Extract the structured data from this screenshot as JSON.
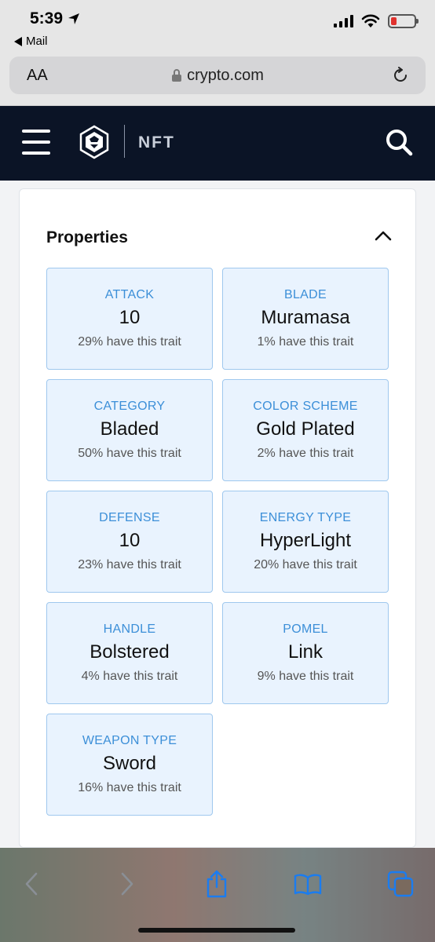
{
  "status": {
    "time": "5:39",
    "back_app": "Mail"
  },
  "browser": {
    "text_size_label": "AA",
    "url": "crypto.com"
  },
  "site": {
    "section_label": "NFT"
  },
  "properties": {
    "title": "Properties",
    "traits": [
      {
        "label": "ATTACK",
        "value": "10",
        "rarity": "29% have this trait"
      },
      {
        "label": "BLADE",
        "value": "Muramasa",
        "rarity": "1% have this trait"
      },
      {
        "label": "CATEGORY",
        "value": "Bladed",
        "rarity": "50% have this trait"
      },
      {
        "label": "COLOR SCHEME",
        "value": "Gold Plated",
        "rarity": "2% have this trait"
      },
      {
        "label": "DEFENSE",
        "value": "10",
        "rarity": "23% have this trait"
      },
      {
        "label": "ENERGY TYPE",
        "value": "HyperLight",
        "rarity": "20% have this trait"
      },
      {
        "label": "HANDLE",
        "value": "Bolstered",
        "rarity": "4% have this trait"
      },
      {
        "label": "POMEL",
        "value": "Link",
        "rarity": "9% have this trait"
      },
      {
        "label": "WEAPON TYPE",
        "value": "Sword",
        "rarity": "16% have this trait"
      }
    ]
  },
  "colors": {
    "header_bg": "#0b1426",
    "trait_bg": "#e9f3fe",
    "trait_border": "#9fc8ee",
    "trait_label": "#3c8fd8",
    "battery_low": "#e0322e",
    "toolbar_icon": "#1a7cf0"
  },
  "icons": {
    "location": "location-arrow-icon",
    "lock": "lock-icon",
    "reload": "reload-icon",
    "menu": "hamburger-menu-icon",
    "logo": "crypto-com-logo",
    "search": "search-icon",
    "collapse": "chevron-up-icon",
    "back": "chevron-left-icon",
    "forward": "chevron-right-icon",
    "share": "share-icon",
    "bookmarks": "book-icon",
    "tabs": "tabs-icon"
  }
}
